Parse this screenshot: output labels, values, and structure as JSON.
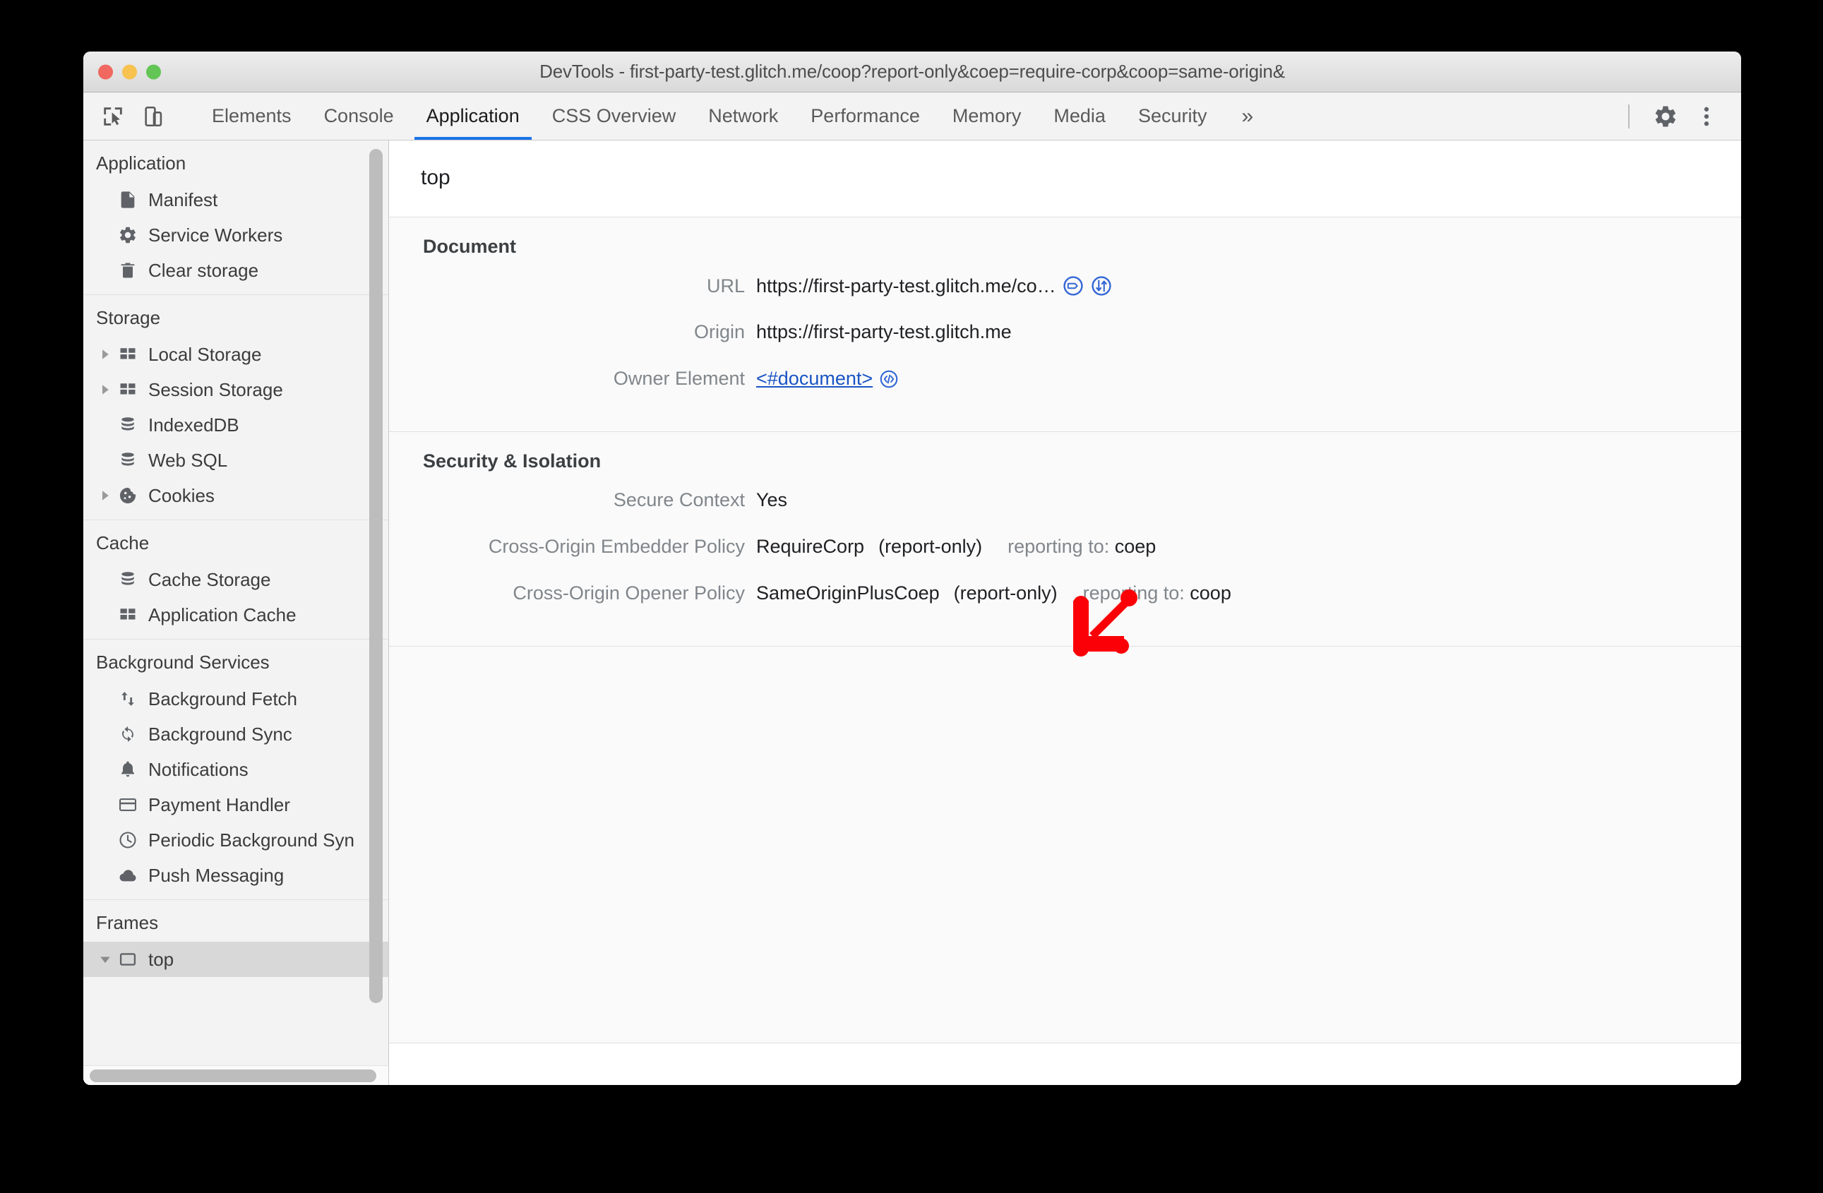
{
  "window": {
    "title": "DevTools - first-party-test.glitch.me/coop?report-only&coep=require-corp&coop=same-origin&",
    "controls": {
      "close": "close",
      "minimize": "minimize",
      "maximize": "maximize"
    }
  },
  "toolbar": {
    "inspect_icon": "inspect-element-icon",
    "device_icon": "device-toolbar-icon",
    "tabs": [
      {
        "label": "Elements",
        "active": false
      },
      {
        "label": "Console",
        "active": false
      },
      {
        "label": "Application",
        "active": true
      },
      {
        "label": "CSS Overview",
        "active": false
      },
      {
        "label": "Network",
        "active": false
      },
      {
        "label": "Performance",
        "active": false
      },
      {
        "label": "Memory",
        "active": false
      },
      {
        "label": "Media",
        "active": false
      },
      {
        "label": "Security",
        "active": false
      }
    ],
    "more_tabs_label": "»",
    "settings_icon": "gear-icon",
    "menu_icon": "more-vertical-icon",
    "active_tab_color": "#1a73e8"
  },
  "sidebar": {
    "sections": [
      {
        "header": "Application",
        "items": [
          {
            "label": "Manifest",
            "icon": "document-icon",
            "twisty": false,
            "selected": false
          },
          {
            "label": "Service Workers",
            "icon": "gear-icon",
            "twisty": false,
            "selected": false
          },
          {
            "label": "Clear storage",
            "icon": "trash-icon",
            "twisty": false,
            "selected": false
          }
        ]
      },
      {
        "header": "Storage",
        "items": [
          {
            "label": "Local Storage",
            "icon": "table-icon",
            "twisty": true,
            "selected": false
          },
          {
            "label": "Session Storage",
            "icon": "table-icon",
            "twisty": true,
            "selected": false
          },
          {
            "label": "IndexedDB",
            "icon": "database-icon",
            "twisty": false,
            "selected": false
          },
          {
            "label": "Web SQL",
            "icon": "database-icon",
            "twisty": false,
            "selected": false
          },
          {
            "label": "Cookies",
            "icon": "cookie-icon",
            "twisty": true,
            "selected": false
          }
        ]
      },
      {
        "header": "Cache",
        "items": [
          {
            "label": "Cache Storage",
            "icon": "database-icon",
            "twisty": false,
            "selected": false
          },
          {
            "label": "Application Cache",
            "icon": "table-icon",
            "twisty": false,
            "selected": false
          }
        ]
      },
      {
        "header": "Background Services",
        "items": [
          {
            "label": "Background Fetch",
            "icon": "updown-arrows-icon",
            "twisty": false,
            "selected": false
          },
          {
            "label": "Background Sync",
            "icon": "sync-icon",
            "twisty": false,
            "selected": false
          },
          {
            "label": "Notifications",
            "icon": "bell-icon",
            "twisty": false,
            "selected": false
          },
          {
            "label": "Payment Handler",
            "icon": "credit-card-icon",
            "twisty": false,
            "selected": false
          },
          {
            "label": "Periodic Background Syn",
            "icon": "clock-icon",
            "twisty": false,
            "selected": false
          },
          {
            "label": "Push Messaging",
            "icon": "cloud-icon",
            "twisty": false,
            "selected": false
          }
        ]
      },
      {
        "header": "Frames",
        "items": [
          {
            "label": "top",
            "icon": "frame-icon",
            "twisty": true,
            "twisty_open": true,
            "selected": true
          }
        ]
      }
    ]
  },
  "main": {
    "frame_title": "top",
    "sections": [
      {
        "title": "Document",
        "rows": [
          {
            "key": "URL",
            "value": "https://first-party-test.glitch.me/co…",
            "icons": [
              "open-in-sources-icon",
              "open-in-network-icon"
            ]
          },
          {
            "key": "Origin",
            "value": "https://first-party-test.glitch.me",
            "icons": []
          },
          {
            "key": "Owner Element",
            "value": "<#document>",
            "link": true,
            "icons": [
              "reveal-in-elements-icon"
            ]
          }
        ]
      },
      {
        "title": "Security & Isolation",
        "rows": [
          {
            "key": "Secure Context",
            "value": "Yes",
            "icons": []
          },
          {
            "key": "Cross-Origin Embedder Policy",
            "value": "RequireCorp",
            "status": "(report-only)",
            "report_label": "reporting to:",
            "report_value": "coep",
            "icons": []
          },
          {
            "key": "Cross-Origin Opener Policy",
            "value": "SameOriginPlusCoep",
            "status": "(report-only)",
            "report_label": "reporting to:",
            "report_value": "coop",
            "icons": []
          }
        ]
      }
    ]
  },
  "annotation": {
    "arrow": "red-down-left-arrow",
    "color": "#fb0007"
  }
}
